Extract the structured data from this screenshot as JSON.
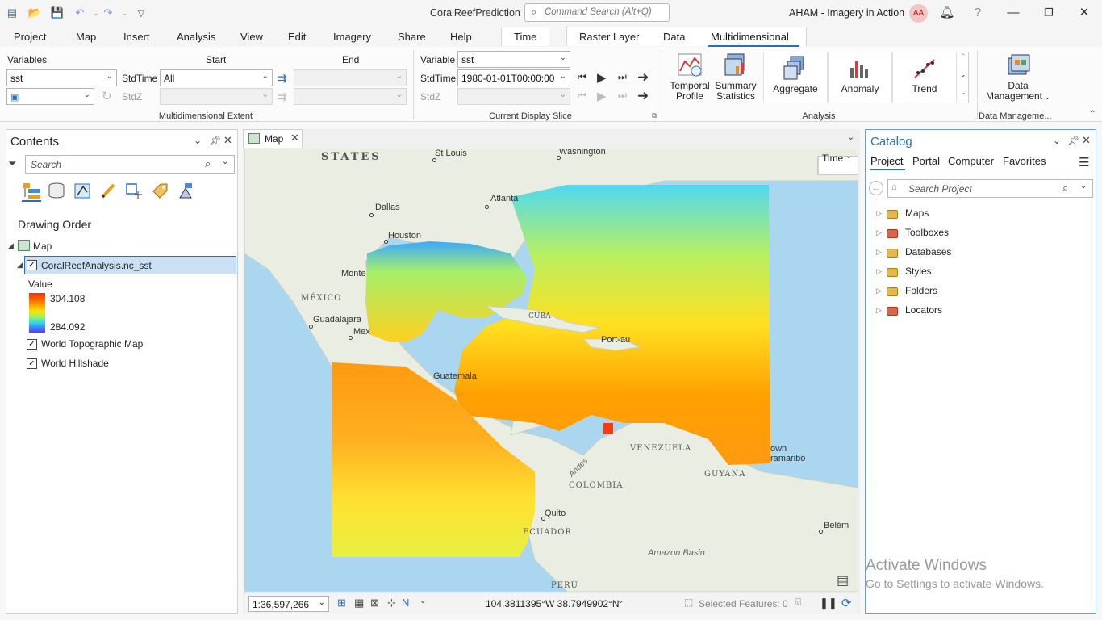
{
  "titlebar": {
    "app_title": "CoralReefPrediction",
    "command_search_placeholder": "Command Search (Alt+Q)",
    "project_name": "AHAM - Imagery in Action",
    "user_initials": "AA"
  },
  "menu_tabs": [
    "Project",
    "Map",
    "Insert",
    "Analysis",
    "View",
    "Edit",
    "Imagery",
    "Share",
    "Help",
    "Time",
    "Raster Layer",
    "Data",
    "Multidimensional"
  ],
  "ribbon": {
    "variables_label": "Variables",
    "variable_value": "sst",
    "start_label": "Start",
    "end_label": "End",
    "stdtime_label": "StdTime",
    "stdtime_start": "All",
    "stdz_label": "StdZ",
    "extent_group": "Multidimensional Extent",
    "variable_label": "Variable",
    "display_variable": "sst",
    "display_stdtime": "1980-01-01T00:00:00",
    "display_group": "Current Display Slice",
    "analysis": {
      "temporal_profile": "Temporal Profile",
      "summary_statistics": "Summary Statistics",
      "aggregate": "Aggregate",
      "anomaly": "Anomaly",
      "trend": "Trend",
      "group": "Analysis"
    },
    "data_management": "Data Management",
    "data_management_group": "Data Manageme..."
  },
  "contents": {
    "title": "Contents",
    "search_placeholder": "Search",
    "drawing_order": "Drawing Order",
    "map_name": "Map",
    "layers": [
      {
        "name": "CoralReefAnalysis.nc_sst",
        "checked": true
      },
      {
        "name": "World Topographic Map",
        "checked": true
      },
      {
        "name": "World Hillshade",
        "checked": true
      }
    ],
    "legend_title": "Value",
    "legend_max": "304.108",
    "legend_min": "284.092"
  },
  "map": {
    "tab_label": "Map",
    "time_button": "Time",
    "labels": [
      "STATES",
      "St Louis",
      "Washington",
      "Atlanta",
      "Dallas",
      "Houston",
      "MÉXICO",
      "Monte",
      "Guadalajara",
      "Mex",
      "CUBA",
      "Port-au",
      "Guatemala",
      "VENEZUELA",
      "COLOMBIA",
      "Andes",
      "GUYANA",
      "own",
      "ramaribo",
      "Quito",
      "ECUADOR",
      "Belém",
      "Amazon Basin",
      "PERÚ"
    ],
    "scale": "1:36,597,266",
    "coordinates": "104.3811395°W 38.7949902°N",
    "selected_features": "Selected Features: 0"
  },
  "catalog": {
    "title": "Catalog",
    "tabs": [
      "Project",
      "Portal",
      "Computer",
      "Favorites"
    ],
    "search_placeholder": "Search Project",
    "items": [
      "Maps",
      "Toolboxes",
      "Databases",
      "Styles",
      "Folders",
      "Locators"
    ]
  },
  "watermark": {
    "line1": "Activate Windows",
    "line2": "Go to Settings to activate Windows."
  },
  "colors": {
    "accent": "#2a6ebb",
    "selection": "#cce0f5",
    "legend_high": "#ff3a00",
    "legend_low": "#5a3cff"
  }
}
